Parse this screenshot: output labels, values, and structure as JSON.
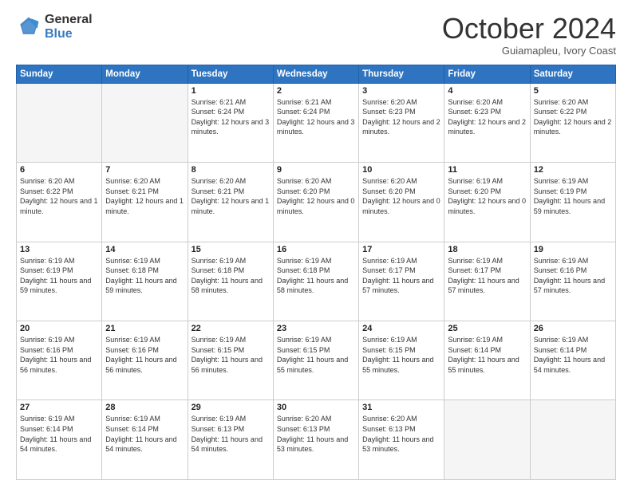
{
  "header": {
    "logo_general": "General",
    "logo_blue": "Blue",
    "month_title": "October 2024",
    "subtitle": "Guiamapleu, Ivory Coast"
  },
  "weekdays": [
    "Sunday",
    "Monday",
    "Tuesday",
    "Wednesday",
    "Thursday",
    "Friday",
    "Saturday"
  ],
  "weeks": [
    [
      {
        "day": "",
        "info": ""
      },
      {
        "day": "",
        "info": ""
      },
      {
        "day": "1",
        "info": "Sunrise: 6:21 AM\nSunset: 6:24 PM\nDaylight: 12 hours and 3 minutes."
      },
      {
        "day": "2",
        "info": "Sunrise: 6:21 AM\nSunset: 6:24 PM\nDaylight: 12 hours and 3 minutes."
      },
      {
        "day": "3",
        "info": "Sunrise: 6:20 AM\nSunset: 6:23 PM\nDaylight: 12 hours and 2 minutes."
      },
      {
        "day": "4",
        "info": "Sunrise: 6:20 AM\nSunset: 6:23 PM\nDaylight: 12 hours and 2 minutes."
      },
      {
        "day": "5",
        "info": "Sunrise: 6:20 AM\nSunset: 6:22 PM\nDaylight: 12 hours and 2 minutes."
      }
    ],
    [
      {
        "day": "6",
        "info": "Sunrise: 6:20 AM\nSunset: 6:22 PM\nDaylight: 12 hours and 1 minute."
      },
      {
        "day": "7",
        "info": "Sunrise: 6:20 AM\nSunset: 6:21 PM\nDaylight: 12 hours and 1 minute."
      },
      {
        "day": "8",
        "info": "Sunrise: 6:20 AM\nSunset: 6:21 PM\nDaylight: 12 hours and 1 minute."
      },
      {
        "day": "9",
        "info": "Sunrise: 6:20 AM\nSunset: 6:20 PM\nDaylight: 12 hours and 0 minutes."
      },
      {
        "day": "10",
        "info": "Sunrise: 6:20 AM\nSunset: 6:20 PM\nDaylight: 12 hours and 0 minutes."
      },
      {
        "day": "11",
        "info": "Sunrise: 6:19 AM\nSunset: 6:20 PM\nDaylight: 12 hours and 0 minutes."
      },
      {
        "day": "12",
        "info": "Sunrise: 6:19 AM\nSunset: 6:19 PM\nDaylight: 11 hours and 59 minutes."
      }
    ],
    [
      {
        "day": "13",
        "info": "Sunrise: 6:19 AM\nSunset: 6:19 PM\nDaylight: 11 hours and 59 minutes."
      },
      {
        "day": "14",
        "info": "Sunrise: 6:19 AM\nSunset: 6:18 PM\nDaylight: 11 hours and 59 minutes."
      },
      {
        "day": "15",
        "info": "Sunrise: 6:19 AM\nSunset: 6:18 PM\nDaylight: 11 hours and 58 minutes."
      },
      {
        "day": "16",
        "info": "Sunrise: 6:19 AM\nSunset: 6:18 PM\nDaylight: 11 hours and 58 minutes."
      },
      {
        "day": "17",
        "info": "Sunrise: 6:19 AM\nSunset: 6:17 PM\nDaylight: 11 hours and 57 minutes."
      },
      {
        "day": "18",
        "info": "Sunrise: 6:19 AM\nSunset: 6:17 PM\nDaylight: 11 hours and 57 minutes."
      },
      {
        "day": "19",
        "info": "Sunrise: 6:19 AM\nSunset: 6:16 PM\nDaylight: 11 hours and 57 minutes."
      }
    ],
    [
      {
        "day": "20",
        "info": "Sunrise: 6:19 AM\nSunset: 6:16 PM\nDaylight: 11 hours and 56 minutes."
      },
      {
        "day": "21",
        "info": "Sunrise: 6:19 AM\nSunset: 6:16 PM\nDaylight: 11 hours and 56 minutes."
      },
      {
        "day": "22",
        "info": "Sunrise: 6:19 AM\nSunset: 6:15 PM\nDaylight: 11 hours and 56 minutes."
      },
      {
        "day": "23",
        "info": "Sunrise: 6:19 AM\nSunset: 6:15 PM\nDaylight: 11 hours and 55 minutes."
      },
      {
        "day": "24",
        "info": "Sunrise: 6:19 AM\nSunset: 6:15 PM\nDaylight: 11 hours and 55 minutes."
      },
      {
        "day": "25",
        "info": "Sunrise: 6:19 AM\nSunset: 6:14 PM\nDaylight: 11 hours and 55 minutes."
      },
      {
        "day": "26",
        "info": "Sunrise: 6:19 AM\nSunset: 6:14 PM\nDaylight: 11 hours and 54 minutes."
      }
    ],
    [
      {
        "day": "27",
        "info": "Sunrise: 6:19 AM\nSunset: 6:14 PM\nDaylight: 11 hours and 54 minutes."
      },
      {
        "day": "28",
        "info": "Sunrise: 6:19 AM\nSunset: 6:14 PM\nDaylight: 11 hours and 54 minutes."
      },
      {
        "day": "29",
        "info": "Sunrise: 6:19 AM\nSunset: 6:13 PM\nDaylight: 11 hours and 54 minutes."
      },
      {
        "day": "30",
        "info": "Sunrise: 6:20 AM\nSunset: 6:13 PM\nDaylight: 11 hours and 53 minutes."
      },
      {
        "day": "31",
        "info": "Sunrise: 6:20 AM\nSunset: 6:13 PM\nDaylight: 11 hours and 53 minutes."
      },
      {
        "day": "",
        "info": ""
      },
      {
        "day": "",
        "info": ""
      }
    ]
  ]
}
